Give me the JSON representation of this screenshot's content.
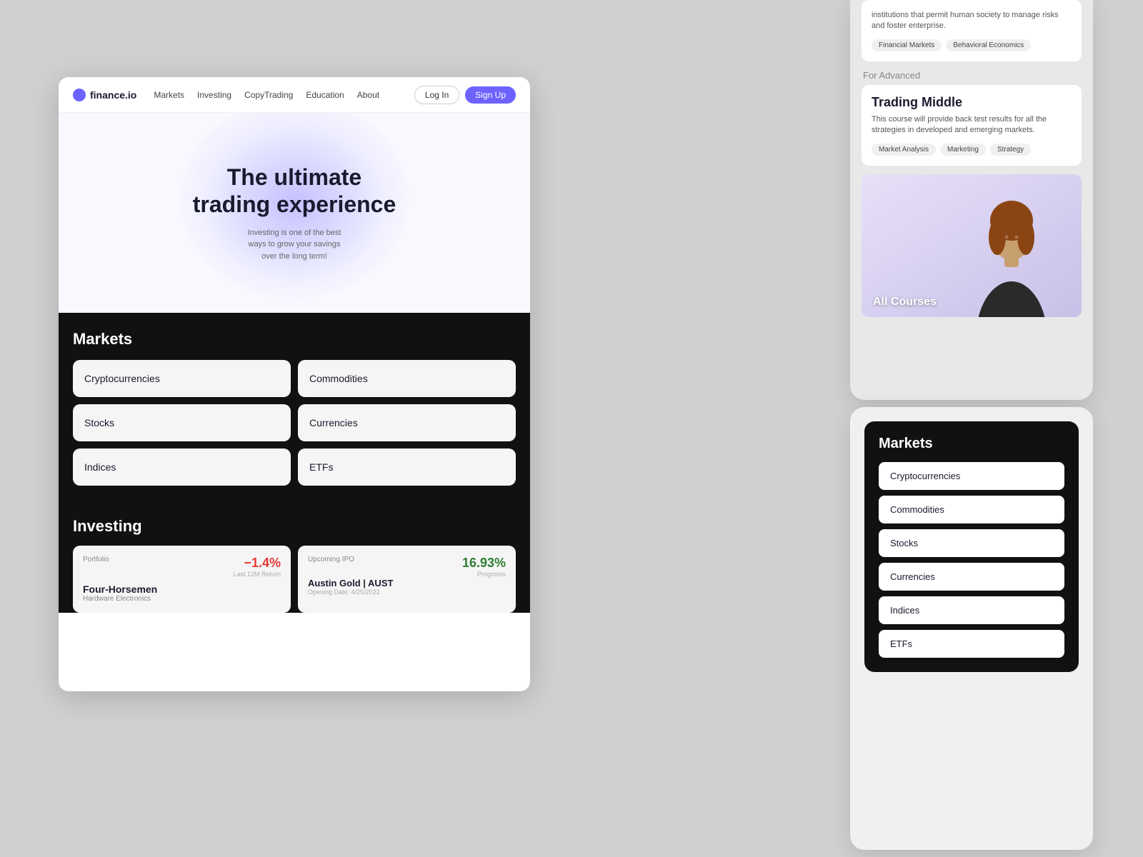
{
  "nav": {
    "logo_text": "finance.io",
    "links": [
      "Markets",
      "Investing",
      "CopyTrading",
      "Education",
      "About"
    ],
    "login_label": "Log In",
    "signup_label": "Sign Up"
  },
  "hero": {
    "line1": "The  ultimate",
    "line2": "trading experience",
    "subtitle_line1": "Investing is one of the best",
    "subtitle_line2": "ways to grow your savings",
    "subtitle_line3": "over the long term!"
  },
  "markets_section": {
    "title": "Markets",
    "cards": [
      "Cryptocurrencies",
      "Commodities",
      "Stocks",
      "Currencies",
      "Indices",
      "ETFs"
    ]
  },
  "investing_section": {
    "title": "Investing",
    "portfolio_label": "Portfolio",
    "portfolio_return_value": "−1.4%",
    "portfolio_return_sublabel": "Last 12M Return",
    "portfolio_name": "Four-Horsemen",
    "portfolio_subname": "Hardware Electronics",
    "ipo_label": "Upcoming IPO",
    "ipo_prognosis_value": "16.93%",
    "ipo_prognosis_sublabel": "Prognosis",
    "ipo_name": "Austin Gold  |  AUST",
    "ipo_date_label": "Opening Date:  4/25/2022"
  },
  "courses_panel": {
    "intro_text": "institutions that permit human society to manage risks and foster enterprise.",
    "intro_tags": [
      "Financial Markets",
      "Behavioral Economics"
    ],
    "for_label": "For Advanced",
    "course_title": "Trading Middle",
    "course_desc": "This course will provide back test results for all the strategies in developed and emerging markets.",
    "course_tags": [
      "Market Analysis",
      "Marketing",
      "Strategy"
    ],
    "all_courses_label": "All Courses"
  },
  "markets_dark_panel": {
    "title": "Markets",
    "items": [
      "Cryptocurrencies",
      "Commodities",
      "Stocks",
      "Currencies",
      "Indices",
      "ETFs"
    ]
  },
  "sidebar_indices": "Indices",
  "sidebar_commodities_top": "Commodities",
  "sidebar_commodities_main": "Commodities",
  "sidebar_indices_main": "Indices"
}
